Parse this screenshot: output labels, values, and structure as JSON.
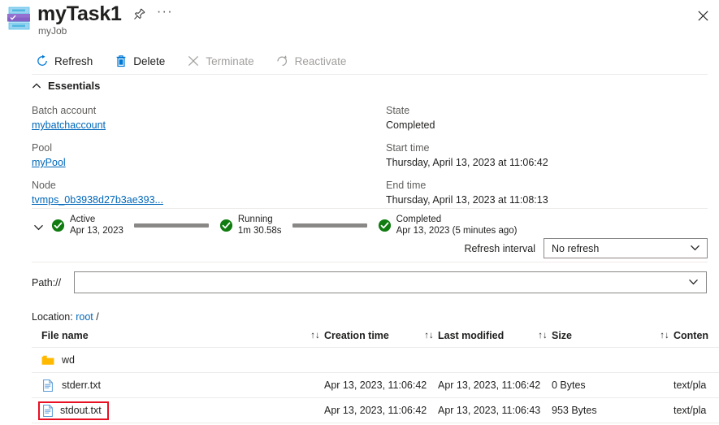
{
  "header": {
    "icon": "batch-task-icon",
    "title": "myTask1",
    "subtitle": "myJob",
    "pin_icon": "pin-icon",
    "more_icon": "ellipsis-icon",
    "close_icon": "close-icon"
  },
  "commands": [
    {
      "label": "Refresh",
      "icon": "refresh-icon",
      "disabled": false
    },
    {
      "label": "Delete",
      "icon": "trash-icon",
      "disabled": false
    },
    {
      "label": "Terminate",
      "icon": "x-icon",
      "disabled": true
    },
    {
      "label": "Reactivate",
      "icon": "reactivate-icon",
      "disabled": true
    }
  ],
  "essentials": {
    "section_label": "Essentials",
    "collapse_icon": "chevron-up-icon",
    "left": [
      {
        "label": "Batch account",
        "value": "mybatchaccount",
        "is_link": true
      },
      {
        "label": "Pool",
        "value": "myPool",
        "is_link": true
      },
      {
        "label": "Node",
        "value": "tvmps_0b3938d27b3ae393...",
        "is_link": true
      }
    ],
    "right": [
      {
        "label": "State",
        "value": "Completed",
        "is_link": false
      },
      {
        "label": "Start time",
        "value": "Thursday, April 13, 2023 at 11:06:42",
        "is_link": false
      },
      {
        "label": "End time",
        "value": "Thursday, April 13, 2023 at 11:08:13",
        "is_link": false
      }
    ]
  },
  "timeline": {
    "expand_icon": "chevron-down-icon",
    "status_color": "#107c10",
    "connector_color": "#8a8886",
    "stages": [
      {
        "name": "Active",
        "detail": "Apr 13, 2023",
        "icon": "check-circle-icon"
      },
      {
        "name": "Running",
        "detail": "1m 30.58s",
        "icon": "check-circle-icon"
      },
      {
        "name": "Completed",
        "detail": "Apr 13, 2023 (5 minutes ago)",
        "icon": "check-circle-icon"
      }
    ]
  },
  "refresh": {
    "label": "Refresh interval",
    "selected": "No refresh",
    "chevron_icon": "chevron-down-icon"
  },
  "path": {
    "label": "Path://",
    "value": "",
    "placeholder": "",
    "chevron_icon": "chevron-down-icon"
  },
  "location": {
    "label": "Location:",
    "link": "root",
    "separator": "/"
  },
  "table": {
    "sort_icon": "sort-arrows-icon",
    "columns": [
      {
        "key": "name",
        "label": "File name",
        "sortable": true
      },
      {
        "key": "created",
        "label": "Creation time",
        "sortable": true
      },
      {
        "key": "modified",
        "label": "Last modified",
        "sortable": true
      },
      {
        "key": "size",
        "label": "Size",
        "sortable": true
      },
      {
        "key": "content",
        "label": "Conten",
        "sortable": false
      }
    ],
    "rows": [
      {
        "icon": "folder-icon",
        "name": "wd",
        "created": "",
        "modified": "",
        "size": "",
        "content": "",
        "highlighted": false
      },
      {
        "icon": "file-icon",
        "name": "stderr.txt",
        "created": "Apr 13, 2023, 11:06:42",
        "modified": "Apr 13, 2023, 11:06:42",
        "size": "0 Bytes",
        "content": "text/pla",
        "highlighted": false
      },
      {
        "icon": "file-icon",
        "name": "stdout.txt",
        "created": "Apr 13, 2023, 11:06:42",
        "modified": "Apr 13, 2023, 11:06:43",
        "size": "953 Bytes",
        "content": "text/pla",
        "highlighted": true
      }
    ]
  },
  "colors": {
    "link": "#0067b8",
    "success": "#107c10",
    "highlight": "#e81123",
    "divider": "#edebe9",
    "folder": "#ffb900"
  }
}
